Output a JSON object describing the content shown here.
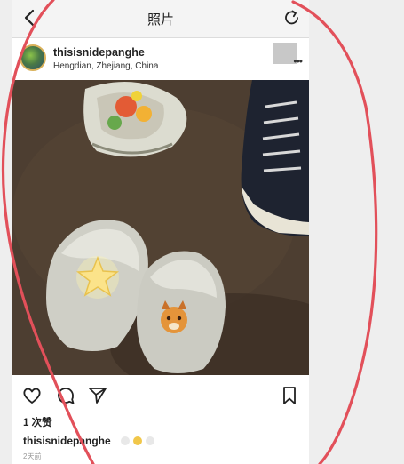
{
  "header": {
    "title": "照片",
    "back_icon": "chevron-left-icon",
    "refresh_icon": "refresh-icon"
  },
  "post": {
    "username": "thisisnidepanghe",
    "location": "Hengdian, Zhejiang, China",
    "more_icon": "more-dots-icon",
    "photo_description_icon": "photo",
    "likes": "1 次赞",
    "caption_user": "thisisnidepanghe",
    "time_ago": "2天前"
  },
  "actions": {
    "like_icon": "heart-icon",
    "comment_icon": "comment-icon",
    "share_icon": "share-icon",
    "save_icon": "bookmark-icon"
  },
  "colors": {
    "annotation_circle": "#e2505a",
    "top_bar": "#f4f4f4",
    "text": "#222222"
  }
}
